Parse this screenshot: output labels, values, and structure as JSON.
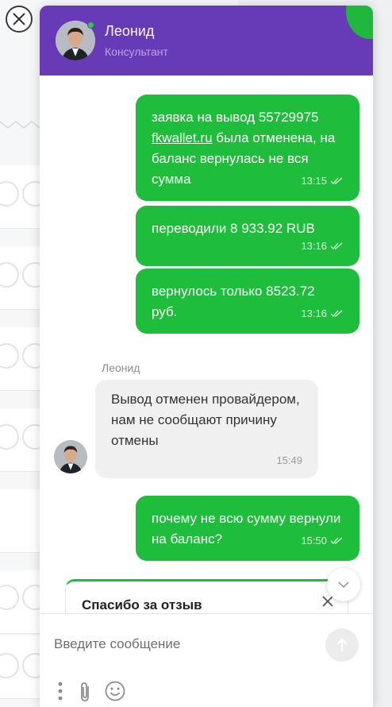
{
  "widget": {
    "close_label": "×",
    "agent_name": "Леонид",
    "agent_role": "Консультант",
    "accent_color": "#673ab7",
    "outgoing_color": "#1ebd3b"
  },
  "messages": [
    {
      "type": "out",
      "text_before": "заявка на вывод 55729975 ",
      "link": "fkwallet.ru",
      "text_after": " была отменена, на баланс вернулась не вся сумма",
      "time": "13:15"
    },
    {
      "type": "out",
      "text": "переводили 8 933.92 RUB",
      "time": "13:16"
    },
    {
      "type": "out",
      "text": "вернулось только 8523.72 руб.",
      "time": "13:16"
    },
    {
      "type": "in",
      "sender": "Леонид",
      "text": "Вывод отменен провайдером, нам не сообщают причину отмены",
      "time": "15:49"
    },
    {
      "type": "out",
      "text": "почему не всю сумму вернули на баланс?",
      "time": "15:50"
    }
  ],
  "rating_card": {
    "title": "Спасибо за отзыв"
  },
  "composer": {
    "placeholder": "Введите сообщение",
    "value": ""
  },
  "icons": {
    "close": "close-icon",
    "send": "send-arrow-icon",
    "more": "more-vertical-icon",
    "attach": "paperclip-icon",
    "emoji": "emoji-icon",
    "read": "double-check-icon",
    "scroll": "chevron-down-icon"
  }
}
